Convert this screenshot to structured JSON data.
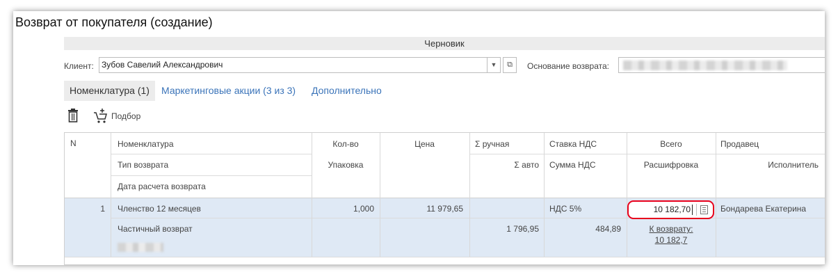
{
  "window": {
    "title": "Возврат от покупателя (создание)"
  },
  "status": {
    "text": "Черновик"
  },
  "client": {
    "label": "Клиент:",
    "value": "Зубов Савелий Александрович"
  },
  "basis": {
    "label": "Основание возврата:"
  },
  "tabs": [
    {
      "label": "Номенклатура (1)"
    },
    {
      "label": "Маркетинговые акции (3 из 3)"
    },
    {
      "label": "Дополнительно"
    }
  ],
  "toolbar": {
    "pick_label": "Подбор",
    "delete_icon": "trash-icon",
    "pick_icon": "cart-add-icon"
  },
  "table": {
    "headers": {
      "n": "N",
      "nomenclature": "Номенклатура",
      "return_type": "Тип возврата",
      "return_date": "Дата расчета возврата",
      "qty": "Кол-во",
      "package": "Упаковка",
      "price": "Цена",
      "sum_manual": "Σ ручная",
      "sum_auto": "Σ авто",
      "vat_rate": "Ставка НДС",
      "vat_sum": "Сумма НДС",
      "total": "Всего",
      "breakdown": "Расшифровка",
      "seller": "Продавец",
      "executor": "Исполнитель"
    },
    "rows": [
      {
        "n": "1",
        "nomenclature": "Членство 12 месяцев",
        "return_type": "Частичный возврат",
        "qty": "1,000",
        "price": "11 979,65",
        "sum_auto": "1 796,95",
        "vat_rate": "НДС 5%",
        "vat_sum": "484,89",
        "total": "10 182,70",
        "breakdown_line1": "К возврату:",
        "breakdown_line2": "10 182,7",
        "seller": "Бондарева Екатерина"
      }
    ]
  },
  "colors": {
    "accent_link": "#3b74b9",
    "row_highlight": "#dfe9f5",
    "focus_ring": "#e8001c"
  }
}
